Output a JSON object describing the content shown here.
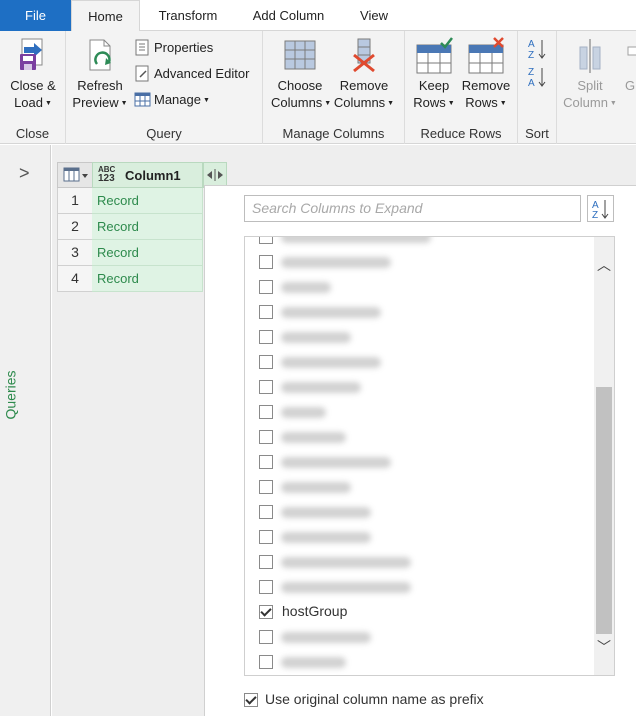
{
  "tabs": [
    "File",
    "Home",
    "Transform",
    "Add Column",
    "View"
  ],
  "ribbon": {
    "close_group": {
      "label": "Close",
      "close_load": [
        "Close &",
        "Load"
      ]
    },
    "query_group": {
      "label": "Query",
      "refresh": [
        "Refresh",
        "Preview"
      ],
      "properties": "Properties",
      "advanced_editor": "Advanced Editor",
      "manage": "Manage"
    },
    "manage_columns_group": {
      "label": "Manage Columns",
      "choose": [
        "Choose",
        "Columns"
      ],
      "remove": [
        "Remove",
        "Columns"
      ]
    },
    "reduce_rows_group": {
      "label": "Reduce Rows",
      "keep": [
        "Keep",
        "Rows"
      ],
      "remove": [
        "Remove",
        "Rows"
      ]
    },
    "sort_group": {
      "label": "Sort"
    },
    "split": {
      "label": [
        "Split",
        "Column"
      ]
    },
    "partial_next": "G"
  },
  "queries_pane": {
    "label": "Queries"
  },
  "grid": {
    "type_icon": [
      "ABC",
      "123"
    ],
    "column_name": "Column1",
    "rows": [
      {
        "num": "1",
        "value": "Record"
      },
      {
        "num": "2",
        "value": "Record"
      },
      {
        "num": "3",
        "value": "Record"
      },
      {
        "num": "4",
        "value": "Record"
      }
    ]
  },
  "expand_popup": {
    "search_placeholder": "Search Columns to Expand",
    "items": [
      {
        "text": "",
        "checked": false
      },
      {
        "text": "",
        "checked": false
      },
      {
        "text": "",
        "checked": false
      },
      {
        "text": "",
        "checked": false
      },
      {
        "text": "",
        "checked": false
      },
      {
        "text": "",
        "checked": false
      },
      {
        "text": "",
        "checked": false
      },
      {
        "text": "",
        "checked": false
      },
      {
        "text": "",
        "checked": false
      },
      {
        "text": "",
        "checked": false
      },
      {
        "text": "",
        "checked": false
      },
      {
        "text": "",
        "checked": false
      },
      {
        "text": "",
        "checked": false
      },
      {
        "text": "",
        "checked": false
      },
      {
        "text": "",
        "checked": false
      },
      {
        "text": "hostGroup",
        "checked": true
      },
      {
        "text": "",
        "checked": false
      },
      {
        "text": "",
        "checked": false
      }
    ],
    "use_prefix_label": "Use original column name as prefix",
    "use_prefix_checked": true
  },
  "colors": {
    "file_tab": "#1e6fc4",
    "record_green": "#2d8a4c",
    "remove_red": "#e04a2f"
  }
}
